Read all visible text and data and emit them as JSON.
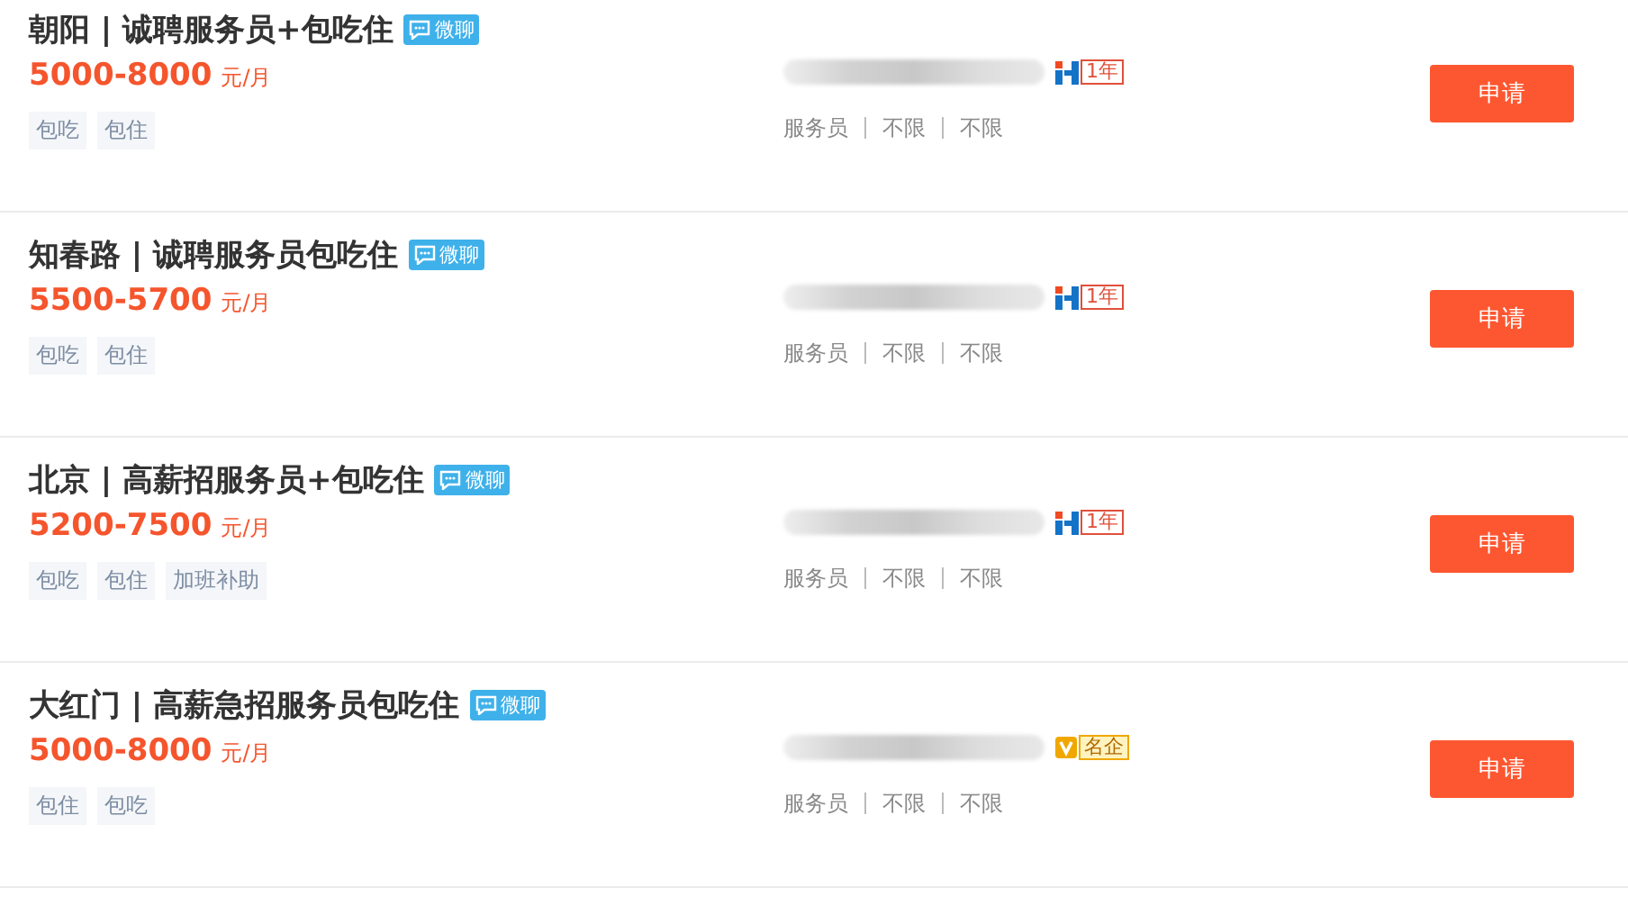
{
  "jobs": [
    {
      "title": "朝阳 | 诚聘服务员+包吃住",
      "chat": "微聊",
      "salary": "5000-8000",
      "unit": "元/月",
      "tags": [
        "包吃",
        "包住"
      ],
      "badge": {
        "kind": "years",
        "text": "1年"
      },
      "details": [
        "服务员",
        "不限",
        "不限"
      ],
      "apply": "申请"
    },
    {
      "title": "知春路 | 诚聘服务员包吃住",
      "chat": "微聊",
      "salary": "5500-5700",
      "unit": "元/月",
      "tags": [
        "包吃",
        "包住"
      ],
      "badge": {
        "kind": "years",
        "text": "1年"
      },
      "details": [
        "服务员",
        "不限",
        "不限"
      ],
      "apply": "申请"
    },
    {
      "title": "北京 | 高薪招服务员+包吃住",
      "chat": "微聊",
      "salary": "5200-7500",
      "unit": "元/月",
      "tags": [
        "包吃",
        "包住",
        "加班补助"
      ],
      "badge": {
        "kind": "years",
        "text": "1年"
      },
      "details": [
        "服务员",
        "不限",
        "不限"
      ],
      "apply": "申请"
    },
    {
      "title": "大红门 | 高薪急招服务员包吃住",
      "chat": "微聊",
      "salary": "5000-8000",
      "unit": "元/月",
      "tags": [
        "包住",
        "包吃"
      ],
      "badge": {
        "kind": "famous",
        "text": "名企"
      },
      "details": [
        "服务员",
        "不限",
        "不限"
      ],
      "apply": "申请"
    }
  ]
}
